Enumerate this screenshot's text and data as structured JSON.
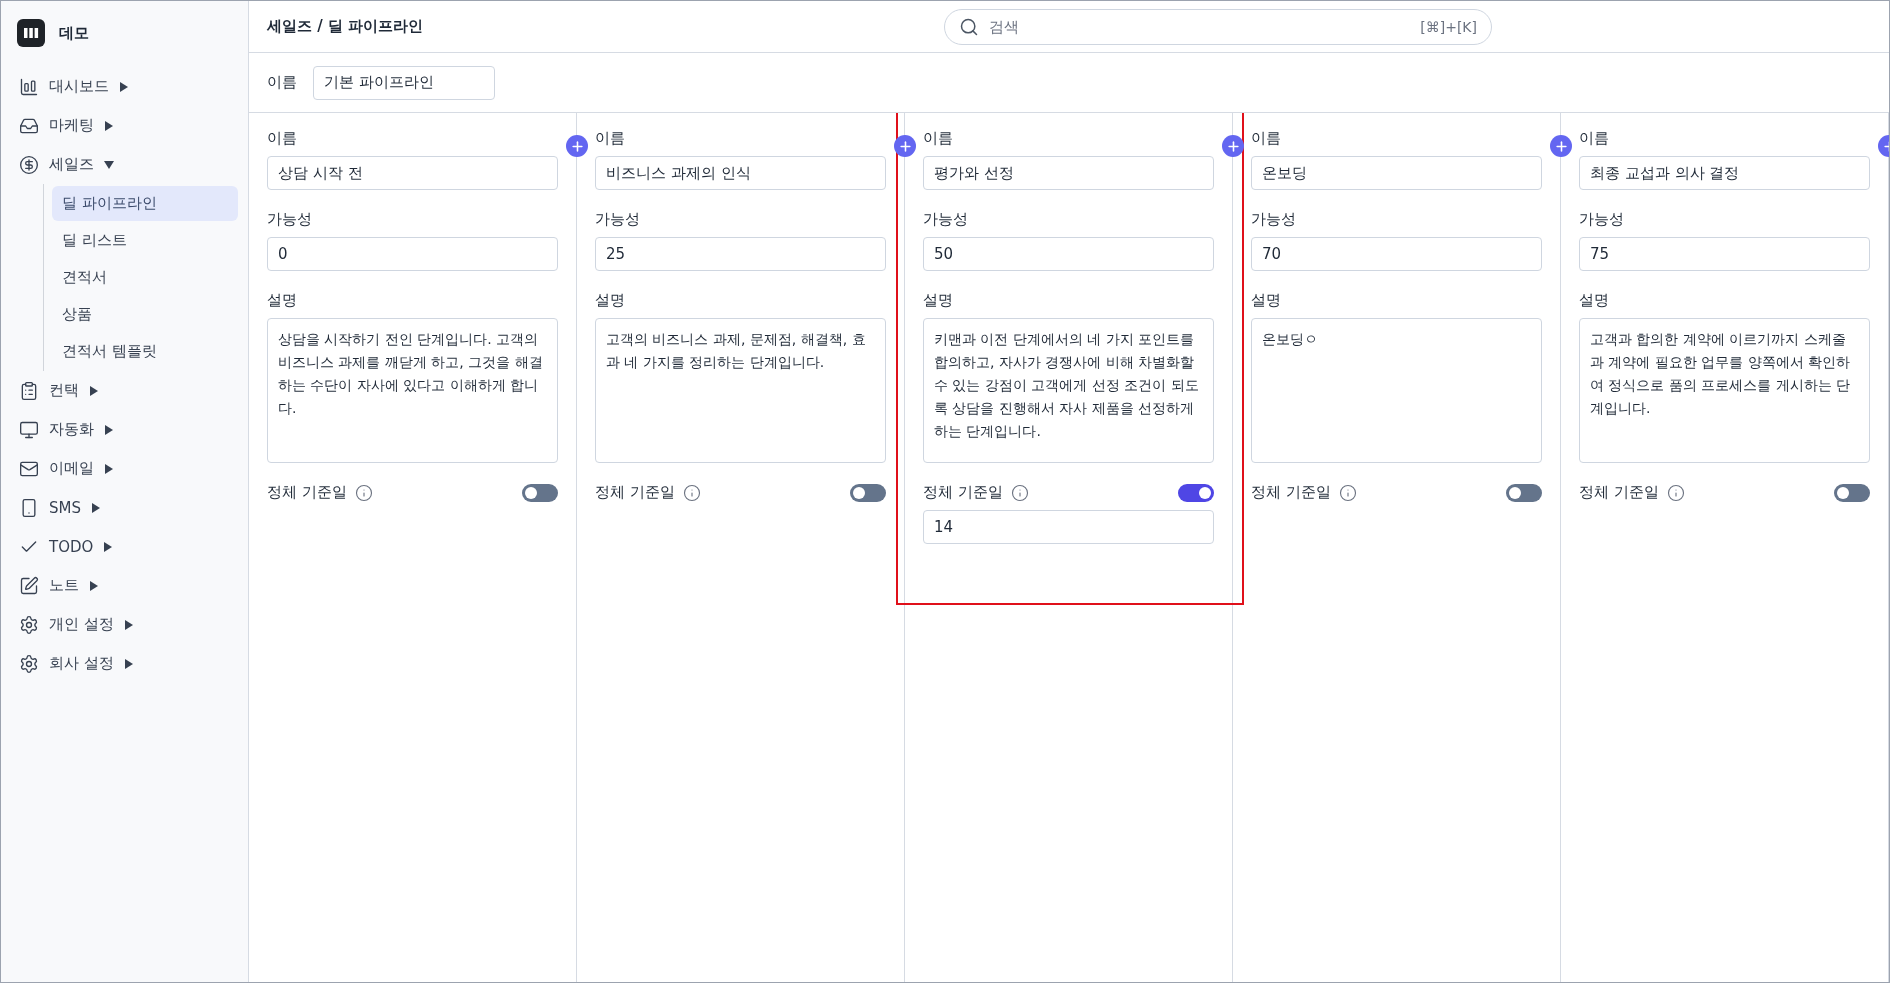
{
  "app": {
    "name": "데모"
  },
  "sidebar": {
    "items": [
      {
        "label": "대시보드",
        "expanded": false
      },
      {
        "label": "마케팅",
        "expanded": false
      },
      {
        "label": "세일즈",
        "expanded": true,
        "children": [
          {
            "label": "딜 파이프라인",
            "selected": true
          },
          {
            "label": "딜 리스트",
            "selected": false
          },
          {
            "label": "견적서",
            "selected": false
          },
          {
            "label": "상품",
            "selected": false
          },
          {
            "label": "견적서 템플릿",
            "selected": false
          }
        ]
      },
      {
        "label": "컨택",
        "expanded": false
      },
      {
        "label": "자동화",
        "expanded": false
      },
      {
        "label": "이메일",
        "expanded": false
      },
      {
        "label": "SMS",
        "expanded": false
      },
      {
        "label": "TODO",
        "expanded": false
      },
      {
        "label": "노트",
        "expanded": false
      },
      {
        "label": "개인 설정",
        "expanded": false
      },
      {
        "label": "회사 설정",
        "expanded": false
      }
    ]
  },
  "header": {
    "breadcrumb": "세일즈 / 딜 파이프라인",
    "search": {
      "placeholder": "검색",
      "shortcut": "[⌘]+[K]"
    }
  },
  "pipeline": {
    "name_label": "이름",
    "name": "기본 파이프라인"
  },
  "stages": [
    {
      "name_label": "이름",
      "name": "상담 시작 전",
      "probability_label": "가능성",
      "probability": "0",
      "description_label": "설명",
      "description": "상담을 시작하기 전인 단계입니다. 고객의 비즈니스 과제를 깨닫게 하고, 그것을 해결하는 수단이 자사에 있다고 이해하게 합니다.",
      "stall_label": "정체 기준일",
      "stall_on": false,
      "highlighted": false
    },
    {
      "name_label": "이름",
      "name": "비즈니스 과제의 인식",
      "probability_label": "가능성",
      "probability": "25",
      "description_label": "설명",
      "description": "고객의 비즈니스 과제, 문제점, 해결책, 효과 네 가지를 정리하는 단계입니다.",
      "stall_label": "정체 기준일",
      "stall_on": false,
      "highlighted": false
    },
    {
      "name_label": "이름",
      "name": "평가와 선정",
      "probability_label": "가능성",
      "probability": "50",
      "description_label": "설명",
      "description": "키맨과 이전 단계에서의 네 가지 포인트를 합의하고, 자사가 경쟁사에 비해 차별화할 수 있는 강점이 고객에게 선정 조건이 되도록 상담을 진행해서 자사 제품을 선정하게 하는 단계입니다.",
      "stall_label": "정체 기준일",
      "stall_on": true,
      "stall_days": "14",
      "highlighted": true
    },
    {
      "name_label": "이름",
      "name": "온보딩",
      "probability_label": "가능성",
      "probability": "70",
      "description_label": "설명",
      "description": "온보딩ㅇ",
      "stall_label": "정체 기준일",
      "stall_on": false,
      "highlighted": false
    },
    {
      "name_label": "이름",
      "name": "최종 교섭과 의사 결정",
      "probability_label": "가능성",
      "probability": "75",
      "description_label": "설명",
      "description": "고객과 합의한 계약에 이르기까지 스케줄과 계약에 필요한 업무를 양쪽에서 확인하여 정식으로 품의 프로세스를 게시하는 단계입니다.",
      "stall_label": "정체 기준일",
      "stall_on": false,
      "highlighted": false
    }
  ]
}
